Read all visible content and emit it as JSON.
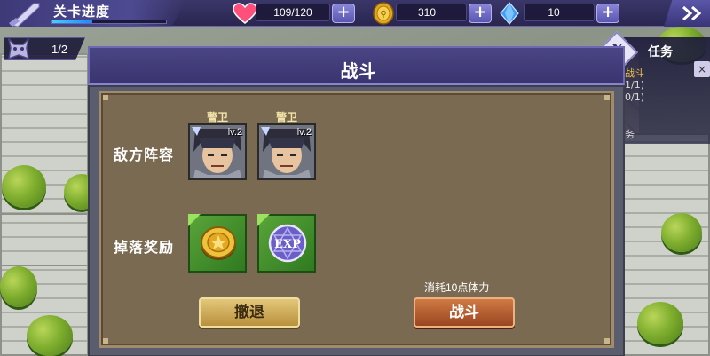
{
  "topbar": {
    "stage_label": "关卡进度",
    "stage_progress": 0.35,
    "stamina": "109/120",
    "coins": "310",
    "gems": "10",
    "plus_label": "+"
  },
  "progress": {
    "text": "1/2"
  },
  "task_panel": {
    "x_label": "X",
    "title": "任务",
    "close_label": "×",
    "line1": "战斗",
    "line2": "1/1)",
    "line3": "0/1)",
    "line4": "务"
  },
  "battle_dialog": {
    "title": "战斗",
    "enemy_row_label": "敌方阵容",
    "reward_row_label": "掉落奖励",
    "enemies": [
      {
        "name": "警卫",
        "level": "lv.2"
      },
      {
        "name": "警卫",
        "level": "lv.2"
      }
    ],
    "rewards": [
      {
        "icon": "gold-coin-icon"
      },
      {
        "icon": "exp-badge-icon",
        "label": "EXP"
      }
    ],
    "retreat_label": "撤退",
    "fight_label": "战斗",
    "cost_text": "消耗10点体力"
  }
}
